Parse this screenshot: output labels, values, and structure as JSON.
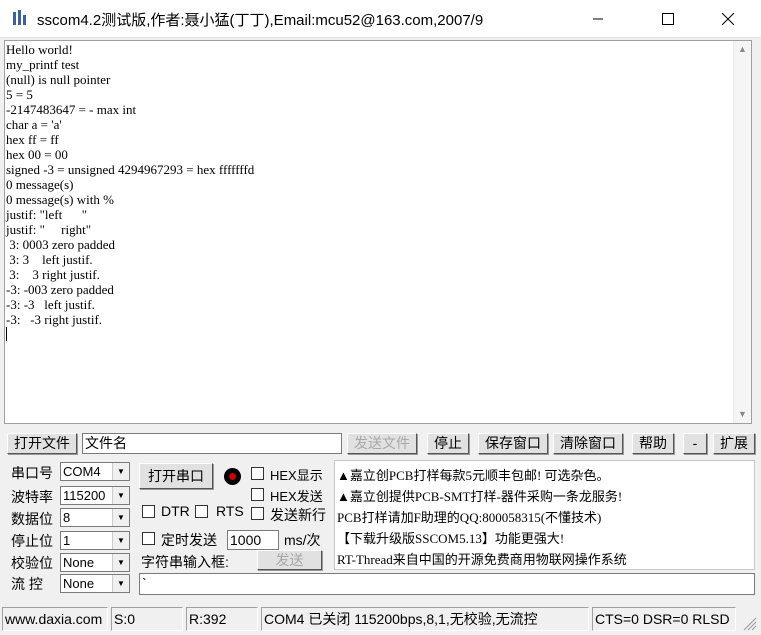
{
  "window": {
    "title": "sscom4.2测试版,作者:聂小猛(丁丁),Email:mcu52@163.com,2007/9",
    "minimize_icon": "minimize-icon",
    "maximize_icon": "maximize-icon",
    "close_icon": "close-icon"
  },
  "terminal": {
    "lines": [
      "Hello world!",
      "my_printf test",
      "(null) is null pointer",
      "5 = 5",
      "-2147483647 = - max int",
      "char a = 'a'",
      "hex ff = ff",
      "hex 00 = 00",
      "signed -3 = unsigned 4294967293 = hex fffffffd",
      "0 message(s)",
      "0 message(s) with %",
      "justif: \"left      \"",
      "justif: \"     right\"",
      " 3: 0003 zero padded",
      " 3: 3    left justif.",
      " 3:    3 right justif.",
      "-3: -003 zero padded",
      "-3: -3   left justif.",
      "-3:   -3 right justif."
    ]
  },
  "file_toolbar": {
    "open_file": "打开文件",
    "filename_value": "文件名",
    "send_file": "发送文件",
    "stop": "停止",
    "save_window": "保存窗口",
    "clear_window": "清除窗口",
    "help": "帮助",
    "minus": "-",
    "expand": "扩展"
  },
  "serial": {
    "port_label": "串口号",
    "port_value": "COM4",
    "baud_label": "波特率",
    "baud_value": "115200",
    "databits_label": "数据位",
    "databits_value": "8",
    "stopbits_label": "停止位",
    "stopbits_value": "1",
    "parity_label": "校验位",
    "parity_value": "None",
    "flow_label": "流 控",
    "flow_value": "None"
  },
  "controls": {
    "open_port": "打开串口",
    "hex_display": "HEX显示",
    "hex_send": "HEX发送",
    "dtr": "DTR",
    "rts": "RTS",
    "send_newline": "发送新行",
    "timed_send": "定时发送",
    "period_value": "1000",
    "period_unit": "ms/次",
    "input_label": "字符串输入框:",
    "send": "发送",
    "send_input_value": "`",
    "led_color": "#d00000"
  },
  "ads": [
    "▲嘉立创PCB打样每款5元顺丰包邮! 可选杂色。",
    "▲嘉立创提供PCB-SMT打样-器件采购一条龙服务!",
    "PCB打样请加F助理的QQ:800058315(不懂技术)",
    "【下载升级版SSCOM5.13】功能更强大!",
    "RT-Thread来自中国的开源免费商用物联网操作系统"
  ],
  "status": {
    "website": "www.daxia.com",
    "sent": "S:0",
    "received": "R:392",
    "port_status": "COM4 已关闭  115200bps,8,1,无校验,无流控",
    "lines": "CTS=0 DSR=0 RLSD"
  }
}
